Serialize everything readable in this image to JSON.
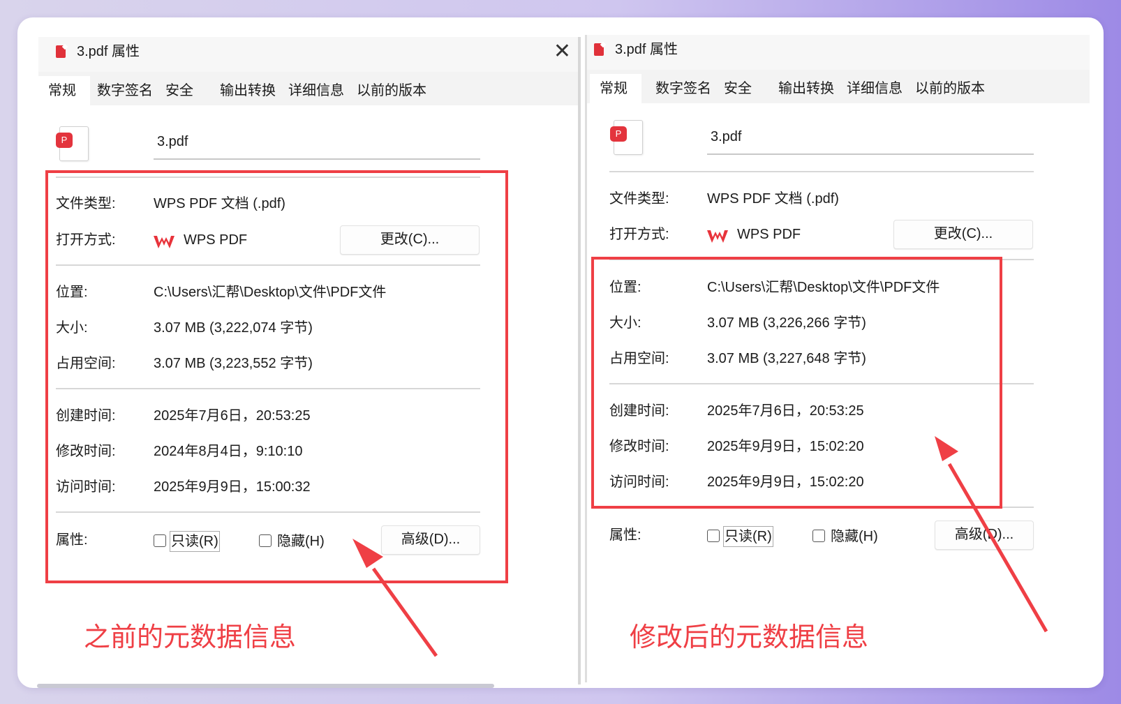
{
  "left": {
    "title": "3.pdf 属性",
    "close_glyph": "✕",
    "tabs": [
      "常规",
      "数字签名",
      "安全",
      "输出转换",
      "详细信息",
      "以前的版本"
    ],
    "filename": "3.pdf",
    "badge_glyph": "P",
    "file_type_label": "文件类型:",
    "file_type": "WPS PDF 文档 (.pdf)",
    "open_with_label": "打开方式:",
    "open_with": "WPS PDF",
    "change_btn": "更改(C)...",
    "location_label": "位置:",
    "location": "C:\\Users\\汇帮\\Desktop\\文件\\PDF文件",
    "size_label": "大小:",
    "size": "3.07 MB (3,222,074 字节)",
    "disk_label": "占用空间:",
    "disk": "3.07 MB (3,223,552 字节)",
    "created_label": "创建时间:",
    "created": "2025年7月6日，20:53:25",
    "modified_label": "修改时间:",
    "modified": "2024年8月4日，9:10:10",
    "accessed_label": "访问时间:",
    "accessed": "2025年9月9日，15:00:32",
    "attr_label": "属性:",
    "readonly": "只读(R)",
    "hidden": "隐藏(H)",
    "advanced_btn": "高级(D)..."
  },
  "right": {
    "title": "3.pdf 属性",
    "tabs": [
      "常规",
      "数字签名",
      "安全",
      "输出转换",
      "详细信息",
      "以前的版本"
    ],
    "filename": "3.pdf",
    "badge_glyph": "P",
    "file_type_label": "文件类型:",
    "file_type": "WPS PDF 文档 (.pdf)",
    "open_with_label": "打开方式:",
    "open_with": "WPS PDF",
    "change_btn": "更改(C)...",
    "location_label": "位置:",
    "location": "C:\\Users\\汇帮\\Desktop\\文件\\PDF文件",
    "size_label": "大小:",
    "size": "3.07 MB (3,226,266 字节)",
    "disk_label": "占用空间:",
    "disk": "3.07 MB (3,227,648 字节)",
    "created_label": "创建时间:",
    "created": "2025年7月6日，20:53:25",
    "modified_label": "修改时间:",
    "modified": "2025年9月9日，15:02:20",
    "accessed_label": "访问时间:",
    "accessed": "2025年9月9日，15:02:20",
    "attr_label": "属性:",
    "readonly": "只读(R)",
    "hidden": "隐藏(H)",
    "advanced_btn": "高级(D)..."
  },
  "captions": {
    "before": "之前的元数据信息",
    "after": "修改后的元数据信息"
  },
  "colors": {
    "highlight": "#ef3f45",
    "pdf_red": "#e3343d",
    "wps_red": "#e8333b"
  }
}
